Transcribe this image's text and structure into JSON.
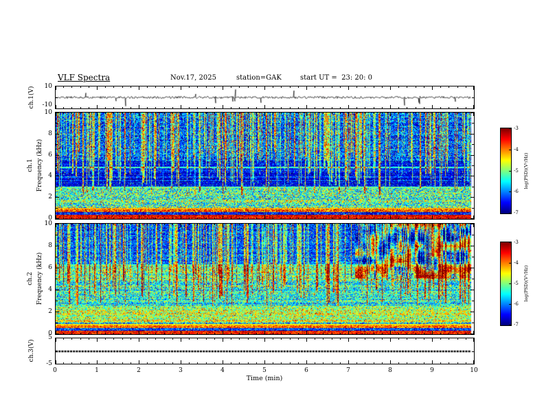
{
  "header": {
    "title": "VLF Spectra",
    "date": "Nov.17, 2025",
    "station": "station=GAK",
    "start_ut": "start UT =  23: 20: 0"
  },
  "panels": {
    "ch1_wave": {
      "label": "ch.1(V)",
      "ymax": "10",
      "ymin": "-10"
    },
    "ch1_spec": {
      "channel": "ch.1",
      "ylabel": "Frequency (kHz)",
      "yticks": [
        0,
        2,
        4,
        6,
        8,
        10
      ]
    },
    "ch2_spec": {
      "channel": "ch.2",
      "ylabel": "Frequency (kHz)",
      "yticks": [
        0,
        2,
        4,
        6,
        8,
        10
      ]
    },
    "ch3_wave": {
      "label": "ch.3(V)",
      "ymax": "5",
      "ymin": "-5"
    }
  },
  "xaxis": {
    "label": "Time (min)",
    "ticks": [
      0,
      1,
      2,
      3,
      4,
      5,
      6,
      7,
      8,
      9,
      10
    ]
  },
  "colorbar": {
    "label": "log(PSD)(V²/Hz)",
    "ticks": [
      -3,
      -4,
      -5,
      -6,
      -7
    ],
    "min": -7,
    "max": -3
  },
  "chart_data": [
    {
      "type": "line",
      "name": "ch1_waveform",
      "title": "ch.1(V) time series",
      "xlabel": "Time (min)",
      "xlim": [
        0,
        10
      ],
      "ylabel": "ch.1(V)",
      "ylim": [
        -10,
        10
      ],
      "baseline": 0,
      "noise_amplitude_V": 1.0,
      "spike_amplitude_V": 8,
      "description": "broadband noisy voltage trace centered on 0 V with sporadic impulsive spikes"
    },
    {
      "type": "heatmap",
      "name": "ch1_spectrogram",
      "title": "ch.1 VLF spectrogram",
      "xlabel": "Time (min)",
      "xlim": [
        0,
        10
      ],
      "ylabel": "Frequency (kHz)",
      "ylim": [
        0,
        10
      ],
      "zlabel": "log(PSD)(V²/Hz)",
      "zlim": [
        -7,
        -3
      ],
      "colormap": "jet",
      "row_striping": 0.3,
      "bands": [
        {
          "f": [
            0,
            0.35
          ],
          "level": -3.5,
          "noise": 0.3,
          "striping": 0.2
        },
        {
          "f": [
            0.35,
            0.6
          ],
          "level": -6.5,
          "noise": 0.4,
          "striping": 0.5
        },
        {
          "f": [
            0.6,
            0.85
          ],
          "level": -3.9,
          "noise": 0.5,
          "striping": 0.3
        },
        {
          "f": [
            0.85,
            1.1
          ],
          "level": -5.6,
          "noise": 0.7,
          "striping": 1.0
        },
        {
          "f": [
            1.1,
            2.9
          ],
          "level": -5.2,
          "noise": 0.6,
          "striping": 1.2
        },
        {
          "f": [
            2.9,
            5.4
          ],
          "level": -6.55,
          "noise": 0.3,
          "striping": 1.4
        },
        {
          "f": [
            5.4,
            10.01
          ],
          "level": -6.15,
          "noise": 0.5,
          "striping": 1.0
        }
      ],
      "hlines": [
        {
          "f": 0.95,
          "level": -4.2,
          "w": 0.05
        },
        {
          "f": 2.95,
          "level": -5.1,
          "w": 0.06
        },
        {
          "f": 4.85,
          "level": -5.3,
          "w": 0.06
        }
      ],
      "stripes": {
        "count": 300,
        "f_base": 2.2,
        "f_spread": 4.5,
        "description": "dense impulsive vertical sferic stripes, mostly above 2.5 kHz"
      }
    },
    {
      "type": "heatmap",
      "name": "ch2_spectrogram",
      "title": "ch.2 VLF spectrogram",
      "xlabel": "Time (min)",
      "xlim": [
        0,
        10
      ],
      "ylabel": "Frequency (kHz)",
      "ylim": [
        0,
        10
      ],
      "zlabel": "log(PSD)(V²/Hz)",
      "zlim": [
        -7,
        -3
      ],
      "colormap": "jet",
      "row_striping": 0.3,
      "bands": [
        {
          "f": [
            0,
            0.3
          ],
          "level": -3.6,
          "noise": 0.3,
          "striping": 0.2
        },
        {
          "f": [
            0.3,
            0.55
          ],
          "level": -6.4,
          "noise": 0.4,
          "striping": 0.5
        },
        {
          "f": [
            0.55,
            0.75
          ],
          "level": -4.0,
          "noise": 0.4,
          "striping": 0.3
        },
        {
          "f": [
            0.75,
            1.0
          ],
          "level": -5.8,
          "noise": 0.6,
          "striping": 1.0
        },
        {
          "f": [
            1.0,
            2.6
          ],
          "level": -4.85,
          "noise": 0.5,
          "striping": 1.3
        },
        {
          "f": [
            2.6,
            6.2
          ],
          "level": -5.35,
          "noise": 0.5,
          "striping": 1.5
        },
        {
          "f": [
            6.2,
            10.01
          ],
          "level": -6.25,
          "noise": 0.4,
          "striping": 1.0
        }
      ],
      "hlines": [
        {
          "f": 0.85,
          "level": -4.4,
          "w": 0.05
        },
        {
          "f": 6.3,
          "level": -5.3,
          "w": 0.05
        }
      ],
      "stripes": {
        "count": 260,
        "f_base": 2.5,
        "f_spread": 4.0,
        "description": "impulsive vertical sferic stripes above ~2.5 kHz"
      },
      "patches": {
        "t_min": 7.2,
        "f_min": 5.0,
        "strength": 4.5,
        "description": "mottled high/low PSD blobs in upper band after ~7.2 min"
      }
    },
    {
      "type": "line",
      "name": "ch3_waveform",
      "title": "ch.3(V) time series",
      "xlabel": "Time (min)",
      "xlim": [
        0,
        10
      ],
      "ylabel": "ch.3(V)",
      "ylim": [
        -5,
        5
      ],
      "baseline": 0,
      "description": "flat thick trace at 0 V (no signal on channel 3)"
    }
  ]
}
